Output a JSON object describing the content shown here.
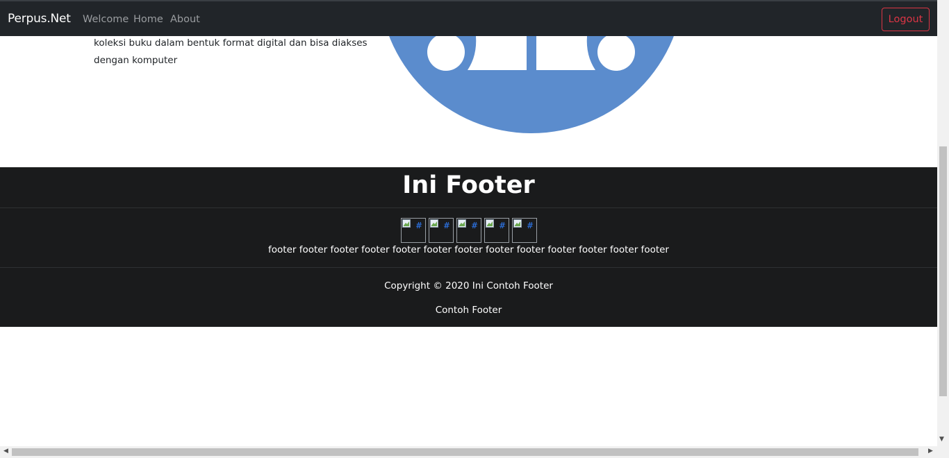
{
  "navbar": {
    "brand": "Perpus.Net",
    "links": [
      "Welcome",
      "Home",
      "About"
    ],
    "logout_label": "Logout",
    "logout_color": "#dc3545"
  },
  "content": {
    "description": "koleksi buku dalam bentuk format digital dan bisa diakses dengan komputer",
    "illustration_color": "#5b8ccd"
  },
  "footer": {
    "title": "Ini Footer",
    "icon_alt": [
      "#",
      "#",
      "#",
      "#",
      "#"
    ],
    "text": "footer footer footer footer footer footer footer footer footer footer footer footer footer",
    "copyright": "Copyright © 2020 Ini Contoh Footer",
    "subtitle": "Contoh Footer",
    "background": "#1a1b1c"
  }
}
